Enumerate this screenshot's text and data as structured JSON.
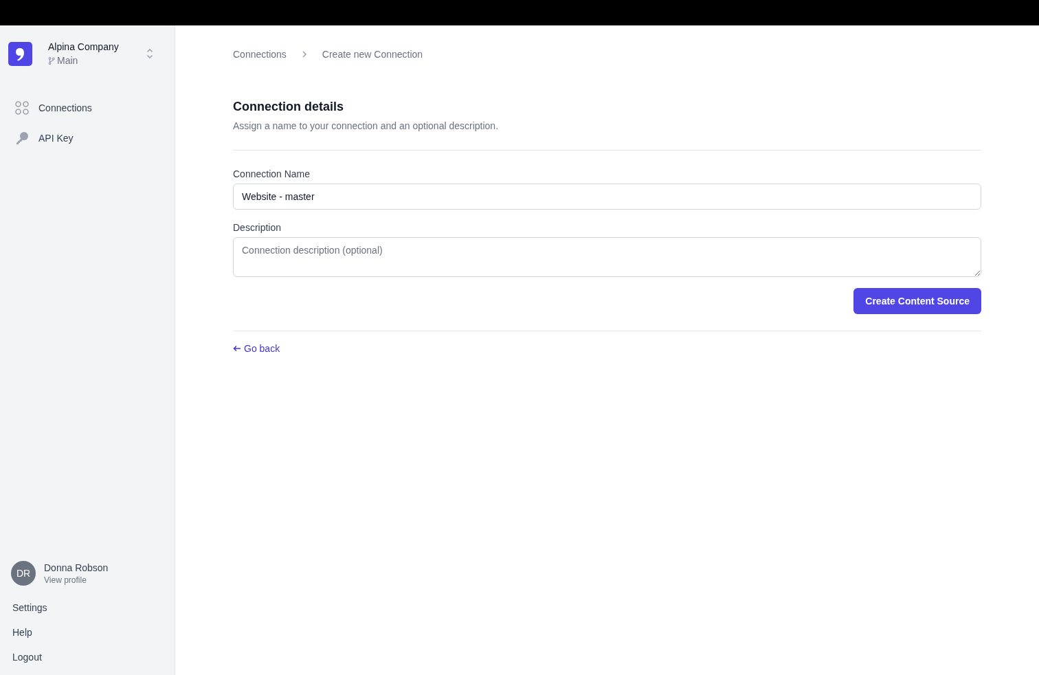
{
  "sidebar": {
    "workspace": {
      "name": "Alpina Company",
      "branch": "Main"
    },
    "nav": [
      {
        "label": "Connections",
        "kind": "grid"
      },
      {
        "label": "API Key",
        "kind": "key"
      }
    ],
    "user": {
      "initials": "DR",
      "name": "Donna Robson",
      "link": "View profile"
    },
    "footer_links": [
      "Settings",
      "Help",
      "Logout"
    ]
  },
  "breadcrumb": [
    "Connections",
    "Create new Connection"
  ],
  "section": {
    "title": "Connection details",
    "description": "Assign a name to your connection and an optional description."
  },
  "form": {
    "name_label": "Connection Name",
    "name_value": "Website - master",
    "description_label": "Description",
    "description_placeholder": "Connection description (optional)",
    "submit": "Create Content Source"
  },
  "back_link": "Go back"
}
